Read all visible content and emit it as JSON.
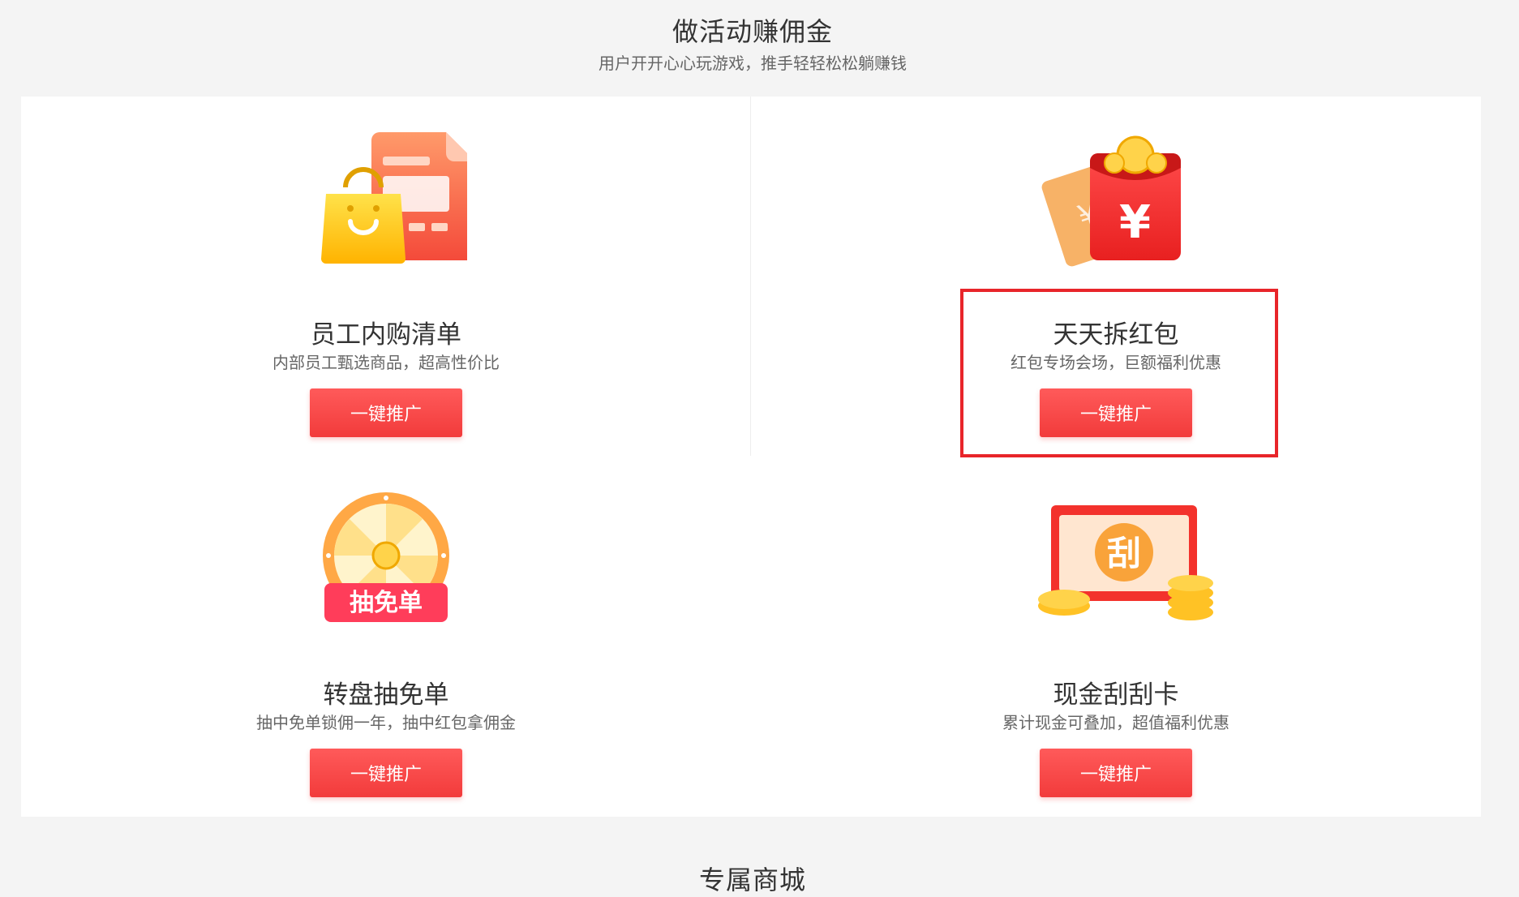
{
  "section": {
    "title": "做活动赚佣金",
    "subtitle": "用户开开心心玩游戏，推手轻轻松松躺赚钱"
  },
  "cards": [
    {
      "title": "员工内购清单",
      "description": "内部员工甄选商品，超高性价比",
      "button_label": "一键推广",
      "icon": "shopping-list-icon"
    },
    {
      "title": "天天拆红包",
      "description": "红包专场会场，巨额福利优惠",
      "button_label": "一键推广",
      "icon": "red-envelope-icon",
      "highlighted": true
    },
    {
      "title": "转盘抽免单",
      "description": "抽中免单锁佣一年，抽中红包拿佣金",
      "button_label": "一键推广",
      "icon": "prize-wheel-icon",
      "icon_text": "抽免单"
    },
    {
      "title": "现金刮刮卡",
      "description": "累计现金可叠加，超值福利优惠",
      "button_label": "一键推广",
      "icon": "scratch-card-icon",
      "icon_text": "刮"
    }
  ],
  "next_section": {
    "title": "专属商城"
  },
  "colors": {
    "accent": "#f23b3b",
    "highlight_border": "#e8252a",
    "background": "#f4f4f4",
    "panel": "#ffffff"
  }
}
